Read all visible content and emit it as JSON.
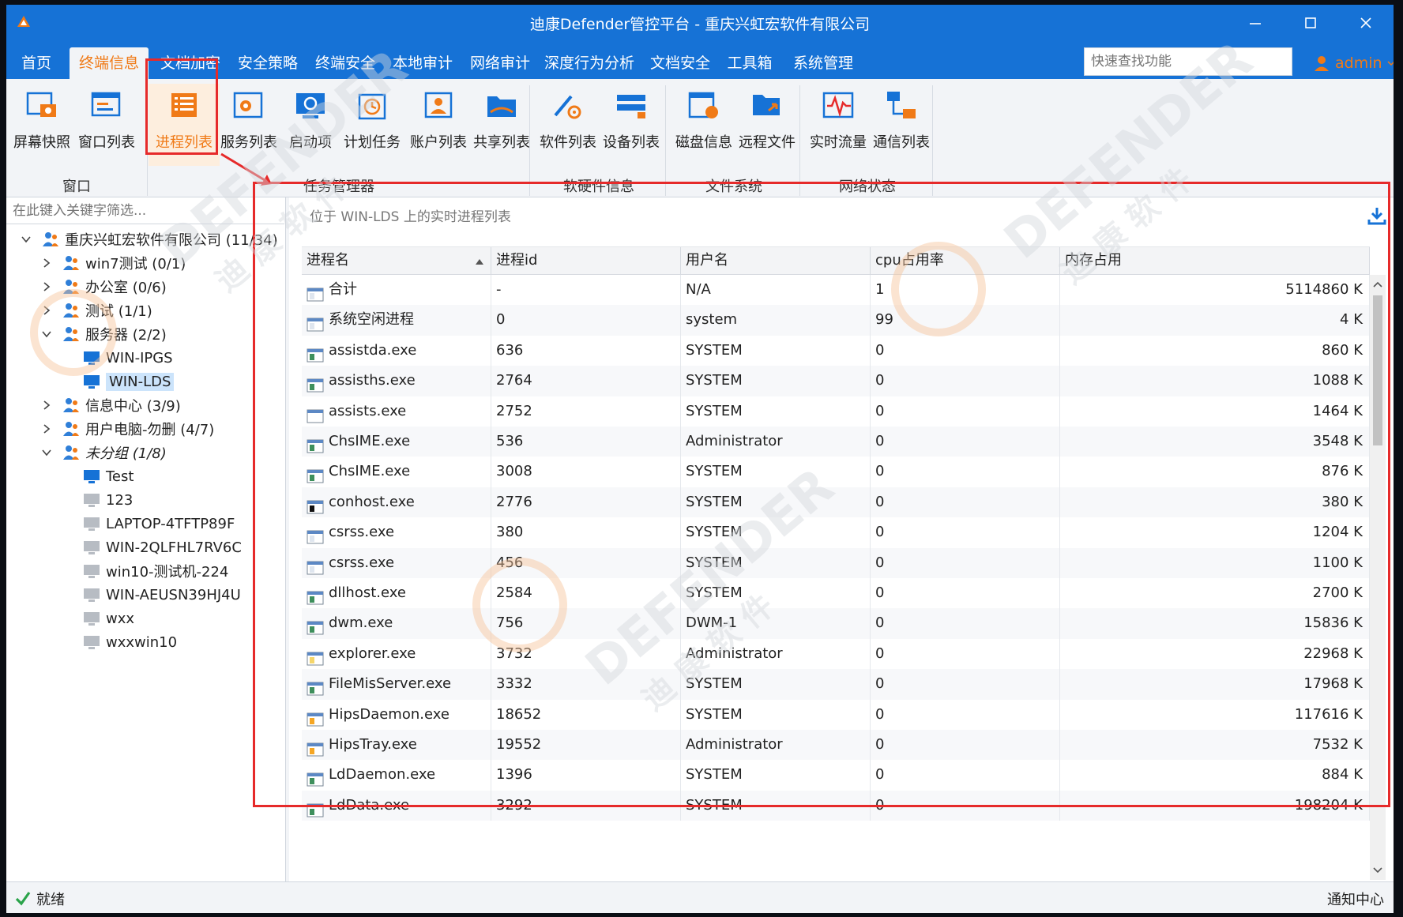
{
  "window": {
    "title": "迪康Defender管控平台 - 重庆兴虹宏软件有限公司"
  },
  "menu": {
    "items": [
      "首页",
      "终端信息",
      "文档加密",
      "安全策略",
      "终端安全",
      "本地审计",
      "网络审计",
      "深度行为分析",
      "文档安全",
      "工具箱",
      "系统管理"
    ],
    "active": "终端信息",
    "search_placeholder": "快速查找功能",
    "user": "admin"
  },
  "ribbon": {
    "buttons": [
      "屏幕快照",
      "窗口列表",
      "进程列表",
      "服务列表",
      "启动项",
      "计划任务",
      "账户列表",
      "共享列表",
      "软件列表",
      "设备列表",
      "磁盘信息",
      "远程文件",
      "实时流量",
      "通信列表"
    ],
    "active": "进程列表",
    "groups": [
      "窗口",
      "任务管理器",
      "软硬件信息",
      "文件系统",
      "网络状态"
    ]
  },
  "tree": {
    "filter_placeholder": "在此键入关键字筛选...",
    "nodes": [
      {
        "label": "重庆兴虹宏软件有限公司 (11/34)",
        "type": "group"
      },
      {
        "label": "win7测试 (0/1)",
        "type": "group"
      },
      {
        "label": "办公室 (0/6)",
        "type": "group"
      },
      {
        "label": "测试 (1/1)",
        "type": "group"
      },
      {
        "label": "服务器 (2/2)",
        "type": "group"
      },
      {
        "label": "WIN-IPGS",
        "type": "online"
      },
      {
        "label": "WIN-LDS",
        "type": "online"
      },
      {
        "label": "信息中心 (3/9)",
        "type": "group"
      },
      {
        "label": "用户电脑-勿删 (4/7)",
        "type": "group"
      },
      {
        "label": "未分组 (1/8)",
        "type": "group"
      },
      {
        "label": "Test",
        "type": "online"
      },
      {
        "label": "123",
        "type": "offline"
      },
      {
        "label": "LAPTOP-4TFTP89F",
        "type": "offline"
      },
      {
        "label": "WIN-2QLFHL7RV6C",
        "type": "offline"
      },
      {
        "label": "win10-测试机-224",
        "type": "offline"
      },
      {
        "label": "WIN-AEUSN39HJ4U",
        "type": "offline"
      },
      {
        "label": "wxx",
        "type": "offline"
      },
      {
        "label": "wxxwin10",
        "type": "offline"
      }
    ],
    "selected": "WIN-LDS"
  },
  "process_panel": {
    "caption": "位于 WIN-LDS 上的实时进程列表",
    "columns": [
      "进程名",
      "进程id",
      "用户名",
      "cpu占用率",
      "内存占用"
    ],
    "rows": [
      [
        "合计",
        "-",
        "N/A",
        "1",
        "5114860 K"
      ],
      [
        "系统空闲进程",
        "0",
        "system",
        "99",
        "4 K"
      ],
      [
        "assistda.exe",
        "636",
        "SYSTEM",
        "0",
        "860 K"
      ],
      [
        "assisths.exe",
        "2764",
        "SYSTEM",
        "0",
        "1088 K"
      ],
      [
        "assists.exe",
        "2752",
        "SYSTEM",
        "0",
        "1464 K"
      ],
      [
        "ChsIME.exe",
        "536",
        "Administrator",
        "0",
        "3548 K"
      ],
      [
        "ChsIME.exe",
        "3008",
        "SYSTEM",
        "0",
        "876 K"
      ],
      [
        "conhost.exe",
        "2776",
        "SYSTEM",
        "0",
        "380 K"
      ],
      [
        "csrss.exe",
        "380",
        "SYSTEM",
        "0",
        "1204 K"
      ],
      [
        "csrss.exe",
        "456",
        "SYSTEM",
        "0",
        "1100 K"
      ],
      [
        "dllhost.exe",
        "2584",
        "SYSTEM",
        "0",
        "2700 K"
      ],
      [
        "dwm.exe",
        "756",
        "DWM-1",
        "0",
        "15836 K"
      ],
      [
        "explorer.exe",
        "3732",
        "Administrator",
        "0",
        "22968 K"
      ],
      [
        "FileMisServer.exe",
        "3332",
        "SYSTEM",
        "0",
        "17968 K"
      ],
      [
        "HipsDaemon.exe",
        "18652",
        "SYSTEM",
        "0",
        "117616 K"
      ],
      [
        "HipsTray.exe",
        "19552",
        "Administrator",
        "0",
        "7532 K"
      ],
      [
        "LdDaemon.exe",
        "1396",
        "SYSTEM",
        "0",
        "884 K"
      ],
      [
        "LdData.exe",
        "3292",
        "SYSTEM",
        "0",
        "198204 K"
      ]
    ]
  },
  "status": {
    "text": "就绪",
    "notify": "通知中心"
  },
  "watermark": {
    "brand": "DEFENDER",
    "chars": "迪 康 软 件"
  },
  "colors": {
    "accent": "#1672d6",
    "active": "#f07a17",
    "highlight": "#e62a2a"
  }
}
